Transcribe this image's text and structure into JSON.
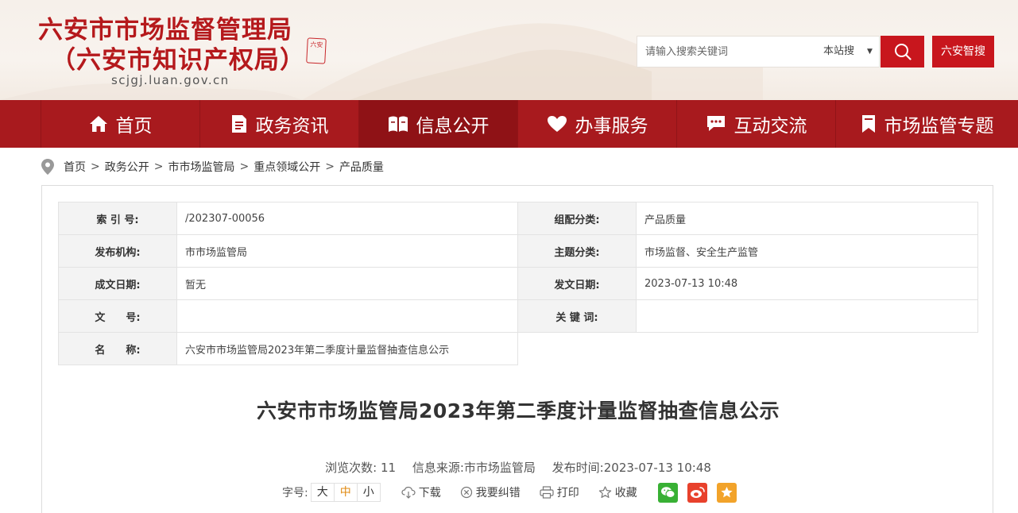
{
  "header": {
    "title_line1": "六安市市场监督管理局",
    "title_line2": "（六安市知识产权局）",
    "domain": "scjgj.luan.gov.cn",
    "seal_text": "六安",
    "search": {
      "placeholder": "请输入搜索关键词",
      "scope": "本站搜",
      "caret": "▼"
    },
    "zhisou_label": "六安智搜"
  },
  "nav": {
    "items": [
      {
        "label": "首页",
        "icon": "home-icon"
      },
      {
        "label": "政务资讯",
        "icon": "document-icon"
      },
      {
        "label": "信息公开",
        "icon": "open-book-icon"
      },
      {
        "label": "办事服务",
        "icon": "heart-icon"
      },
      {
        "label": "互动交流",
        "icon": "chat-icon"
      },
      {
        "label": "市场监管专题",
        "icon": "bookmark-icon"
      }
    ],
    "active_index": 2
  },
  "breadcrumb": [
    "首页",
    "政务公开",
    "市市场监管局",
    "重点领域公开",
    "产品质量"
  ],
  "meta": {
    "index_no_label": "索 引 号:",
    "index_no": "/202307-00056",
    "category_label": "组配分类:",
    "category": "产品质量",
    "publisher_label": "发布机构:",
    "publisher": "市市场监管局",
    "topic_label": "主题分类:",
    "topic": "市场监督、安全生产监管",
    "created_label": "成文日期:",
    "created": "暂无",
    "issued_label": "发文日期:",
    "issued": "2023-07-13 10:48",
    "doc_no_label": "文　　号:",
    "doc_no": "",
    "keywords_label": "关 键 词:",
    "keywords": "",
    "name_label": "名　　称:",
    "name": "六安市市场监管局2023年第二季度计量监督抽查信息公示"
  },
  "article": {
    "title": "六安市市场监管局2023年第二季度计量监督抽查信息公示",
    "views_label": "浏览次数:",
    "views": "11",
    "source_label": "信息来源:",
    "source": "市市场监管局",
    "time_label": "发布时间:",
    "time": "2023-07-13 10:48"
  },
  "toolbar": {
    "fontsize_label": "字号:",
    "sizes": [
      "大",
      "中",
      "小"
    ],
    "download": "下载",
    "report_error": "我要纠错",
    "print": "打印",
    "favorite": "收藏"
  },
  "colors": {
    "brand_red": "#b5191c",
    "nav_bg": "#a81a1e",
    "nav_active": "#8f1216",
    "wechat": "#38b034",
    "weibo": "#e8412c",
    "qzone": "#f2a32a"
  }
}
